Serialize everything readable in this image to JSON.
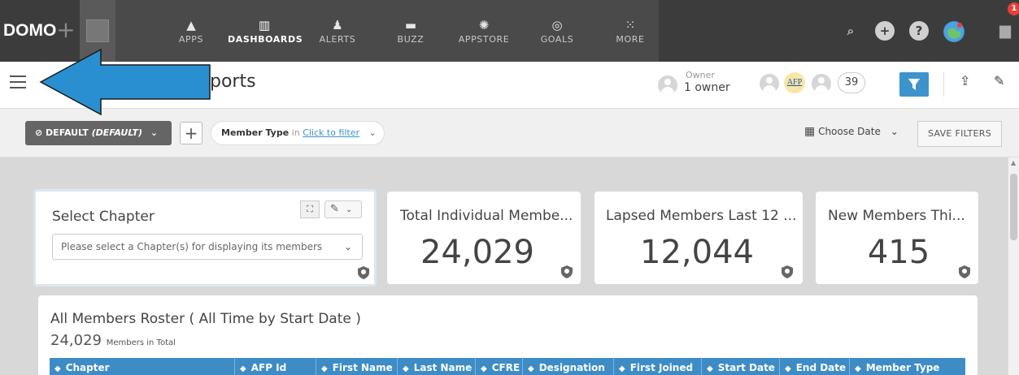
{
  "topnav": {
    "logo": "DOMO",
    "add_label": "+",
    "items": [
      {
        "label": "APPS",
        "icon": "rocket-icon",
        "glyph": "🚀"
      },
      {
        "label": "DASHBOARDS",
        "icon": "dashboard-icon",
        "glyph": "▥"
      },
      {
        "label": "ALERTS",
        "icon": "bell-icon",
        "glyph": "🔔"
      },
      {
        "label": "BUZZ",
        "icon": "chat-icon",
        "glyph": "▬"
      },
      {
        "label": "APPSTORE",
        "icon": "appstore-icon",
        "glyph": "✺"
      },
      {
        "label": "GOALS",
        "icon": "target-icon",
        "glyph": "◎"
      },
      {
        "label": "MORE",
        "icon": "grid-icon",
        "glyph": "⁘"
      }
    ],
    "active": "DASHBOARDS",
    "notification_count": "1"
  },
  "titlebar": {
    "title": "ports",
    "owner_label": "Owner",
    "owner_value": "1 owner",
    "afp_logo_text": "AFP",
    "shared_count": "39"
  },
  "filterbar": {
    "default_prefix": "DEFAULT",
    "default_suffix": "(DEFAULT)",
    "add_label": "+",
    "member_type_label": "Member Type",
    "in_label": "in",
    "click_to_filter": "Click to filter",
    "choose_date": "Choose Date",
    "save_filters": "SAVE FILTERS"
  },
  "cards": {
    "select_chapter": {
      "title": "Select Chapter",
      "placeholder": "Please select a Chapter(s) for displaying its members"
    },
    "total_individual": {
      "title": "Total Individual Membe...",
      "value": "24,029"
    },
    "lapsed": {
      "title": "Lapsed Members Last 12 ...",
      "value": "12,044"
    },
    "new_members": {
      "title": "New Members Thi...",
      "value": "415"
    }
  },
  "roster": {
    "title": "All Members Roster ( All Time by Start Date )",
    "count": "24,029",
    "count_suffix": "Members in Total",
    "columns": [
      "Chapter",
      "AFP Id",
      "First Name",
      "Last Name",
      "CFRE",
      "Designation",
      "First Joined",
      "Start Date",
      "End Date",
      "Member Type"
    ]
  },
  "colors": {
    "nav_bg": "#3c3c3c",
    "accent_blue": "#3d94cc",
    "table_header": "#3d8cc6",
    "arrow_blue": "#2a8fd0"
  }
}
